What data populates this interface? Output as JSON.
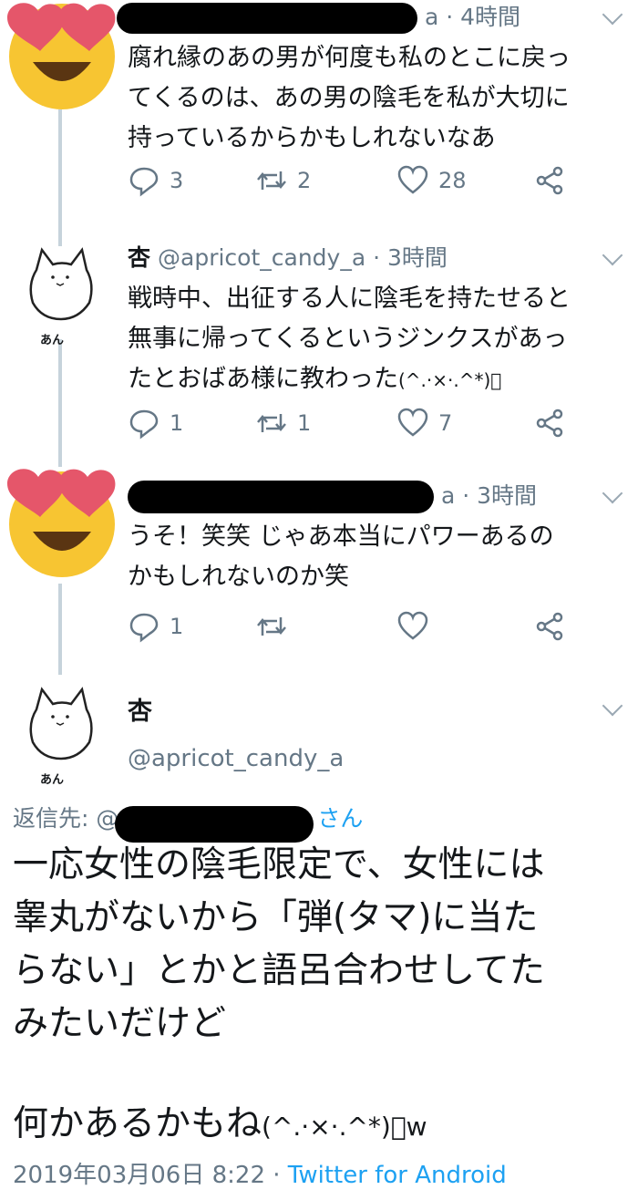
{
  "tweets": [
    {
      "time": "a · 4時間",
      "text": [
        "腐れ縁のあの男が何度も私のとこに戻っ",
        "てくるのは、あの男の陰毛を私が大切に",
        "持っているからかもしれないなあ"
      ],
      "reply_count": "3",
      "retweet_count": "2",
      "like_count": "28"
    },
    {
      "name": "杏",
      "handle": "@apricot_candy_a · 3時間",
      "avatar_caption": "あん",
      "text": [
        "戦時中、出征する人に陰毛を持たせると",
        "無事に帰ってくるというジンクスがあっ"
      ],
      "text_line3": "たとおばあ様に教わった",
      "kaomoji": "(^.·×·.^*)ﾞ",
      "reply_count": "1",
      "retweet_count": "1",
      "like_count": "7"
    },
    {
      "time": "a · 3時間",
      "text": [
        "うそ！笑笑 じゃあ本当にパワーあるの",
        "かもしれないのか笑"
      ],
      "reply_count": "1"
    }
  ],
  "main_tweet": {
    "name": "杏",
    "handle": "@apricot_candy_a",
    "avatar_caption": "あん",
    "reply_prefix": "返信先: @",
    "reply_suffix": "さん",
    "text": [
      "一応女性の陰毛限定で、女性には",
      "睾丸がないから「弾(タマ)に当た",
      "らない」とかと語呂合わせしてた",
      "みたいだけど"
    ],
    "text_last": "何かあるかもね",
    "kaomoji": "(^.·×·.^*)ﾞw",
    "timestamp": "2019年03月06日 8:22 · ",
    "client": "Twitter for Android"
  },
  "colors": {
    "link": "#1da1f2",
    "muted": "#657786",
    "thread": "#c6d3db"
  },
  "icons": [
    "heart-eyes-emoji",
    "cat-avatar",
    "reply-icon",
    "retweet-icon",
    "like-icon",
    "share-icon",
    "chevron-down-icon"
  ]
}
